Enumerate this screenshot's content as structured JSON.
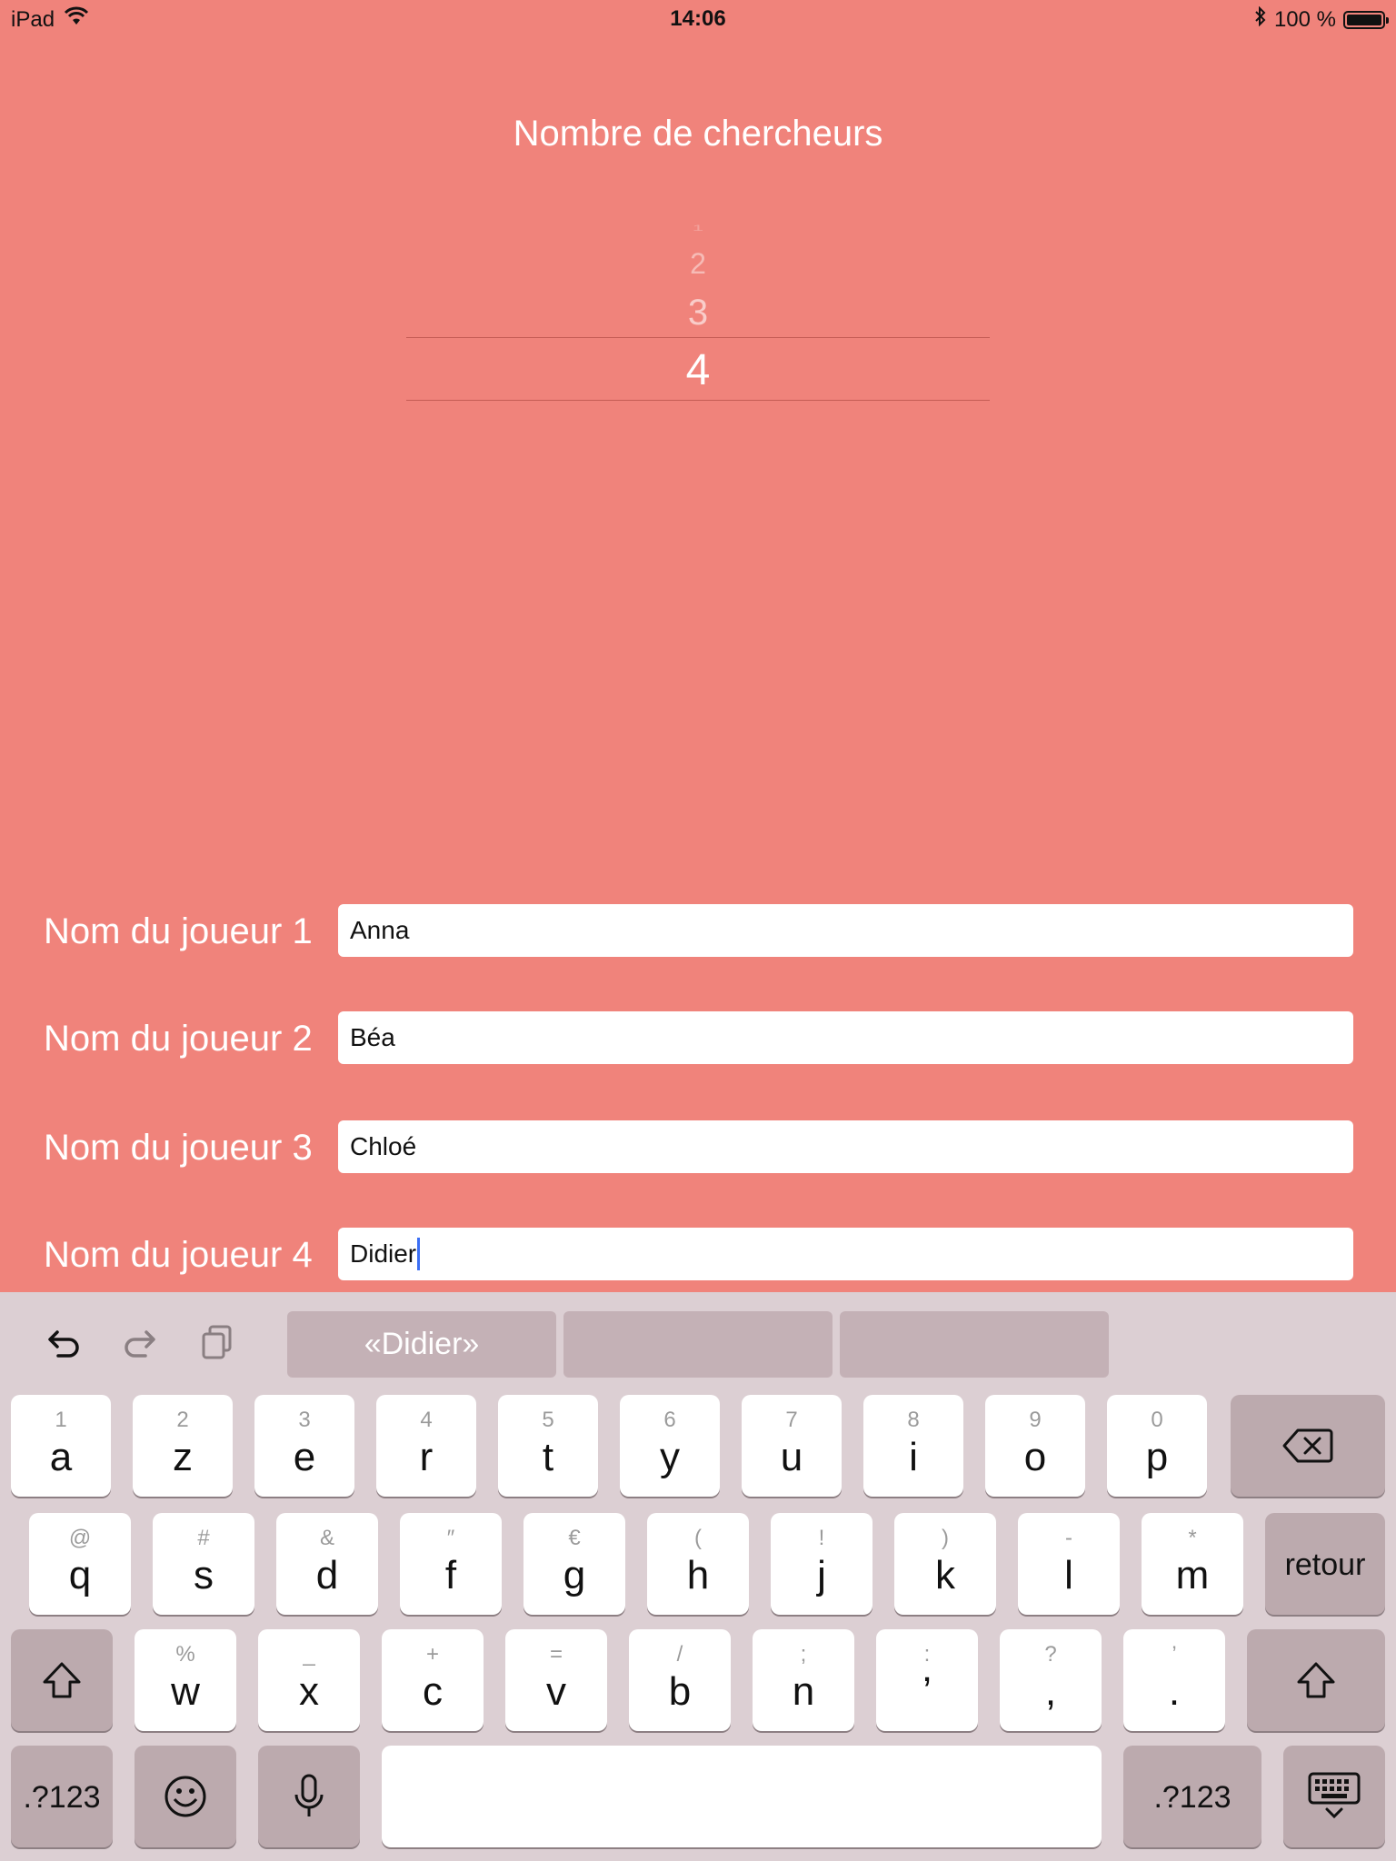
{
  "status_bar": {
    "device": "iPad",
    "time": "14:06",
    "battery": "100 %"
  },
  "title": "Nombre de chercheurs",
  "picker": {
    "options": [
      "1",
      "2",
      "3",
      "4"
    ],
    "selected": "4"
  },
  "players": [
    {
      "label": "Nom du joueur 1",
      "value": "Anna"
    },
    {
      "label": "Nom du joueur 2",
      "value": "Béa"
    },
    {
      "label": "Nom du joueur 3",
      "value": "Chloé"
    },
    {
      "label": "Nom du joueur 4",
      "value": "Didier"
    }
  ],
  "keyboard": {
    "suggestions": [
      "«Didier»",
      "",
      ""
    ],
    "row1": [
      {
        "hint": "1",
        "key": "a"
      },
      {
        "hint": "2",
        "key": "z"
      },
      {
        "hint": "3",
        "key": "e"
      },
      {
        "hint": "4",
        "key": "r"
      },
      {
        "hint": "5",
        "key": "t"
      },
      {
        "hint": "6",
        "key": "y"
      },
      {
        "hint": "7",
        "key": "u"
      },
      {
        "hint": "8",
        "key": "i"
      },
      {
        "hint": "9",
        "key": "o"
      },
      {
        "hint": "0",
        "key": "p"
      }
    ],
    "row2": [
      {
        "hint": "@",
        "key": "q"
      },
      {
        "hint": "#",
        "key": "s"
      },
      {
        "hint": "&",
        "key": "d"
      },
      {
        "hint": "″",
        "key": "f"
      },
      {
        "hint": "€",
        "key": "g"
      },
      {
        "hint": "(",
        "key": "h"
      },
      {
        "hint": "!",
        "key": "j"
      },
      {
        "hint": ")",
        "key": "k"
      },
      {
        "hint": "-",
        "key": "l"
      },
      {
        "hint": "*",
        "key": "m"
      }
    ],
    "row3": [
      {
        "hint": "%",
        "key": "w"
      },
      {
        "hint": "_",
        "key": "x"
      },
      {
        "hint": "+",
        "key": "c"
      },
      {
        "hint": "=",
        "key": "v"
      },
      {
        "hint": "/",
        "key": "b"
      },
      {
        "hint": ";",
        "key": "n"
      },
      {
        "hint": ":",
        "key": "’"
      },
      {
        "hint": "?",
        "key": ","
      },
      {
        "hint": "’",
        "key": "."
      }
    ],
    "return_label": "retour",
    "numbers_label": ".?123",
    "numbers_label_right": ".?123"
  }
}
